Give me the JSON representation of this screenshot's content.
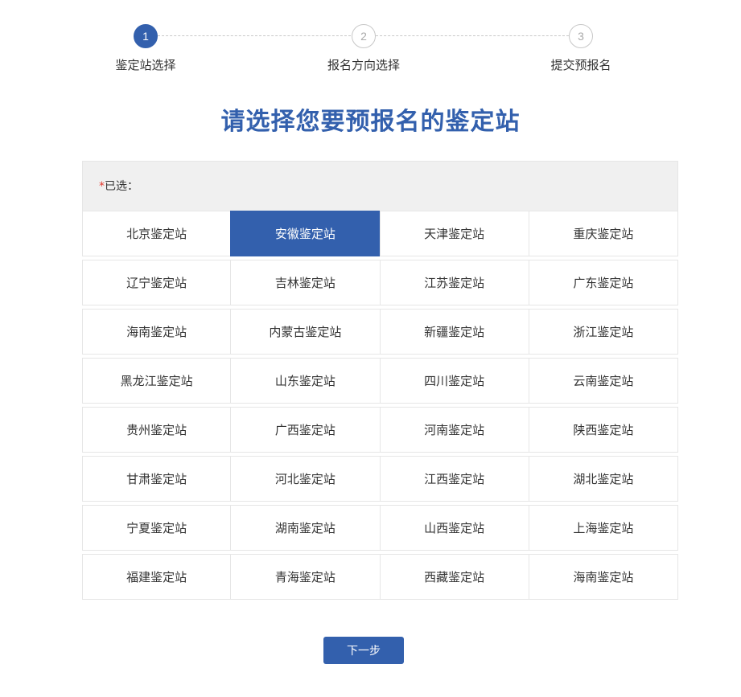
{
  "steps": [
    {
      "number": "1",
      "label": "鉴定站选择",
      "active": true
    },
    {
      "number": "2",
      "label": "报名方向选择",
      "active": false
    },
    {
      "number": "3",
      "label": "提交预报名",
      "active": false
    }
  ],
  "heading": "请选择您要预报名的鉴定站",
  "selected": {
    "required_mark": "*",
    "label": "已选："
  },
  "stations": [
    "北京鉴定站",
    "安徽鉴定站",
    "天津鉴定站",
    "重庆鉴定站",
    "辽宁鉴定站",
    "吉林鉴定站",
    "江苏鉴定站",
    "广东鉴定站",
    "海南鉴定站",
    "内蒙古鉴定站",
    "新疆鉴定站",
    "浙江鉴定站",
    "黑龙江鉴定站",
    "山东鉴定站",
    "四川鉴定站",
    "云南鉴定站",
    "贵州鉴定站",
    "广西鉴定站",
    "河南鉴定站",
    "陕西鉴定站",
    "甘肃鉴定站",
    "河北鉴定站",
    "江西鉴定站",
    "湖北鉴定站",
    "宁夏鉴定站",
    "湖南鉴定站",
    "山西鉴定站",
    "上海鉴定站",
    "福建鉴定站",
    "青海鉴定站",
    "西藏鉴定站",
    "海南鉴定站"
  ],
  "selected_station_index": 1,
  "next_button": "下一步",
  "colors": {
    "accent": "#3360ad",
    "required": "#e23a2e",
    "panel_bg": "#f0f0f0"
  }
}
